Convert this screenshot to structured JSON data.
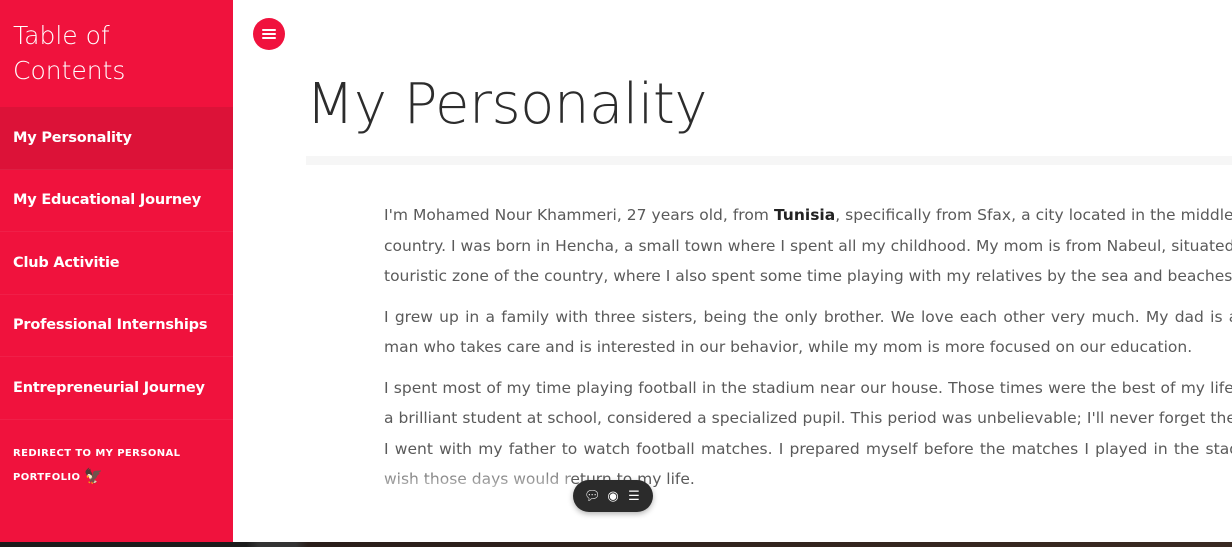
{
  "sidebar": {
    "title": "Table of Contents",
    "items": [
      {
        "label": "My Personality",
        "active": true
      },
      {
        "label": "My Educational Journey",
        "active": false
      },
      {
        "label": "Club Activitie",
        "active": false
      },
      {
        "label": "Professional Internships",
        "active": false
      },
      {
        "label": "Entrepreneurial Journey",
        "active": false
      }
    ],
    "redirect_label": "Redirect to my personal portfolio",
    "redirect_icon": "eagle-icon",
    "accent_color": "#f0123d"
  },
  "header": {
    "menu_icon": "hamburger-menu-icon",
    "page_title": "My Personality"
  },
  "article": {
    "p1_pre": "I'm Mohamed Nour Khammeri, 27 years old, from ",
    "p1_bold": "Tunisia",
    "p1_post": ", specifically from Sfax, a city located in the middle of the country. I was born in Hencha, a small town where I spent all my childhood. My mom is from Nabeul, situated in the touristic zone of the country, where I also spent some time playing with my relatives by the sea and beaches.",
    "p2": "I grew up in a family with three sisters, being the only brother. We love each other very much. My dad is a strict man who takes care and is interested in our behavior, while my mom is more focused on our education.",
    "p3": "I spent most of my time playing football in the stadium near our house. Those times were the best of my life. I was a brilliant student at school, considered a specialized pupil. This period was unbelievable; I'll never forget the times I went with my father to watch football matches. I prepared myself before the matches I played in the stadium. I wish those days would return to my life."
  },
  "floating_toolbar": {
    "icons": [
      "comment-icon",
      "eye-icon",
      "list-icon"
    ]
  }
}
